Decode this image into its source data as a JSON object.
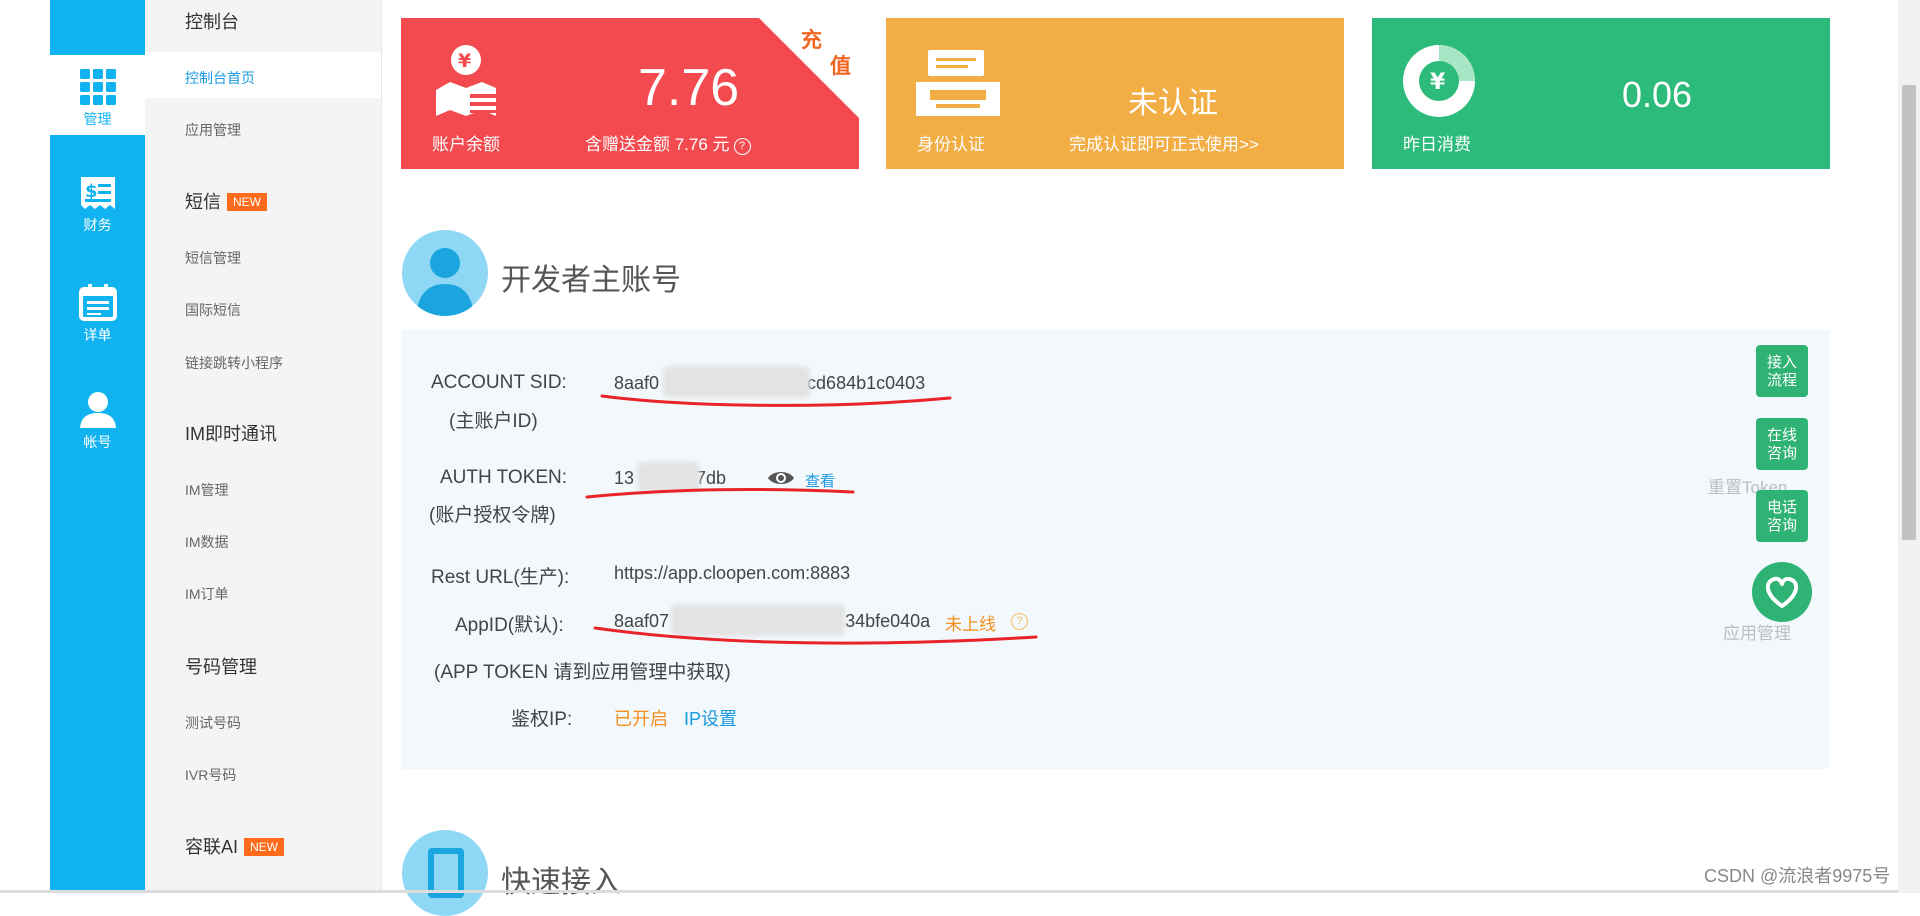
{
  "rail": [
    {
      "label": "管理",
      "icon": "grid-icon"
    },
    {
      "label": "财务",
      "icon": "bill-icon"
    },
    {
      "label": "详单",
      "icon": "calendar-icon"
    },
    {
      "label": "帐号",
      "icon": "user-icon"
    }
  ],
  "subnav": {
    "console": "控制台",
    "console_home": "控制台首页",
    "app_manage": "应用管理",
    "sms": "短信",
    "new_badge": "NEW",
    "sms_manage": "短信管理",
    "intl_sms": "国际短信",
    "link_miniprogram": "链接跳转小程序",
    "im": "IM即时通讯",
    "im_manage": "IM管理",
    "im_data": "IM数据",
    "im_order": "IM订单",
    "number_manage": "号码管理",
    "test_number": "测试号码",
    "ivr_number": "IVR号码",
    "ronglian_ai": "容联AI"
  },
  "cards": {
    "balance": {
      "label": "账户余额",
      "value": "7.76",
      "note": "含赠送金额 7.76 元",
      "help": "?",
      "corner_1": "充",
      "corner_2": "值"
    },
    "identity": {
      "label": "身份认证",
      "status": "未认证",
      "note": "完成认证即可正式使用>>"
    },
    "yesterday": {
      "label": "昨日消费",
      "value": "0.06"
    }
  },
  "developer": {
    "title": "开发者主账号",
    "account_sid_label": "ACCOUNT SID:",
    "account_sid_sub": "(主账户ID)",
    "account_sid_prefix": "8aaf0",
    "account_sid_suffix": "cd684b1c0403",
    "auth_token_label": "AUTH TOKEN:",
    "auth_token_sub": "(账户授权令牌)",
    "auth_token_prefix": "13",
    "auth_token_suffix": "7db",
    "view_label": "查看",
    "rest_url_label": "Rest URL(生产):",
    "rest_url": "https://app.cloopen.com:8883",
    "appid_label": "AppID(默认):",
    "appid_prefix": "8aaf07",
    "appid_suffix": "34bfe040a",
    "appid_status": "未上线",
    "app_token_note": "(APP TOKEN 请到应用管理中获取)",
    "auth_ip_label": "鉴权IP:",
    "auth_ip_status": "已开启",
    "ip_settings": "IP设置",
    "reset_token": "重置Token",
    "app_manage_ghost": "应用管理"
  },
  "float_buttons": {
    "access_flow": [
      "接入",
      "流程"
    ],
    "online_consult": [
      "在线",
      "咨询"
    ],
    "phone_consult": [
      "电话",
      "咨询"
    ]
  },
  "quick_access": {
    "title": "快速接入"
  },
  "watermark": "CSDN @流浪者9975号",
  "colors": {
    "rail": "#10b3f0",
    "red": "#f24a4f",
    "orange": "#f2ad44",
    "green": "#2cbb7a",
    "status_orange": "#f28f1c",
    "link_blue": "#1a9ae0",
    "underline": "#e8232a"
  }
}
